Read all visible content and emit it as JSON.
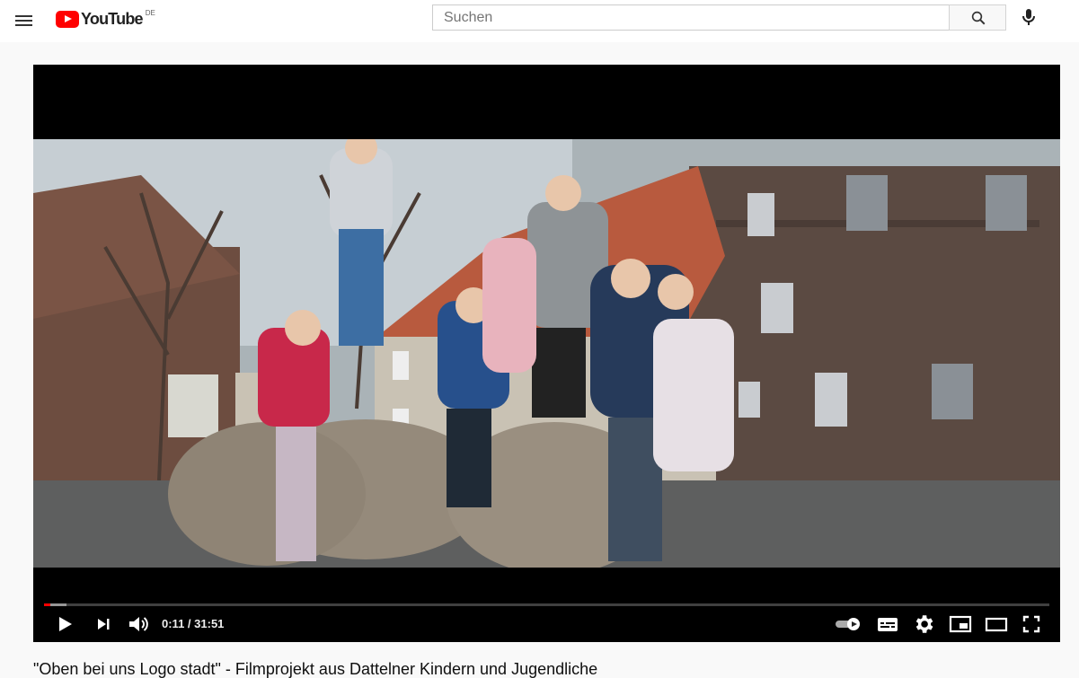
{
  "header": {
    "logo_text": "YouTube",
    "logo_region": "DE",
    "search": {
      "placeholder": "Suchen",
      "value": ""
    }
  },
  "player": {
    "current_time": "0:11",
    "separator": " / ",
    "duration": "31:51",
    "progress_fraction": 0.006,
    "buffer_fraction": 0.022
  },
  "video": {
    "title": "\"Oben bei uns Logo stadt\" - Filmprojekt aus Dattelner Kindern und Jugendliche"
  },
  "colors": {
    "brand_red": "#ff0000",
    "header_bg": "#ffffff",
    "page_bg": "#f9f9f9"
  },
  "icons": [
    "menu-icon",
    "youtube-logo-icon",
    "search-icon",
    "microphone-icon",
    "play-icon",
    "next-icon",
    "volume-icon",
    "autoplay-toggle-icon",
    "subtitles-icon",
    "settings-icon",
    "miniplayer-icon",
    "theater-mode-icon",
    "fullscreen-icon"
  ]
}
